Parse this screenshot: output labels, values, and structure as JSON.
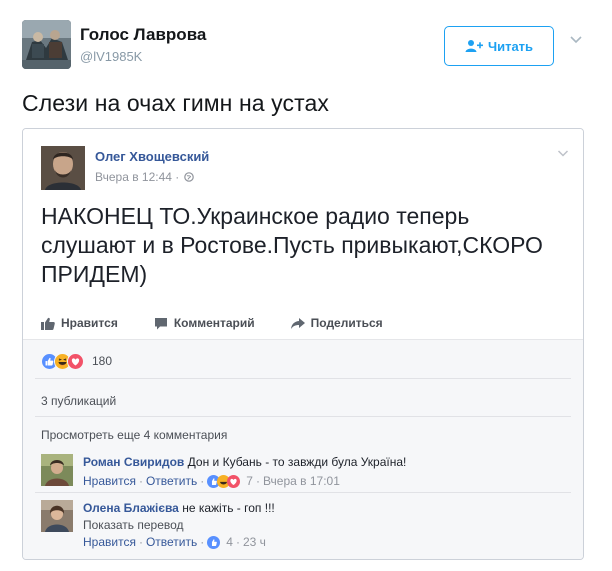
{
  "tweet": {
    "author_name": "Голос Лаврова",
    "author_handle": "@lV1985K",
    "follow_label": "Читать",
    "text": "Слези на очах гимн на устах"
  },
  "fb_post": {
    "author": "Олег Хвощевский",
    "time": "Вчера в 12:44 ·",
    "text": "НАКОНЕЦ ТО.Украинское радио теперь слушают и в Ростове.Пусть привыкают,СКОРО ПРИДЕМ)",
    "actions": {
      "like": "Нравится",
      "comment": "Комментарий",
      "share": "Поделиться"
    },
    "reactions_count": "180",
    "shares_text": "3 публикаций",
    "more_comments": "Просмотреть еще 4 комментария",
    "comments": [
      {
        "author": "Роман Свиридов",
        "text": " Дон и Кубань - то завжди була Україна!",
        "like_label": "Нравится",
        "reply_label": "Ответить",
        "reactions_count": "7",
        "time": "Вчера в 17:01"
      },
      {
        "author": "Олена Блажієва",
        "text": " не кажіть - гоп !!!",
        "translate_label": "Показать перевод",
        "like_label": "Нравится",
        "reply_label": "Ответить",
        "reactions_count": "4",
        "time": "23 ч"
      }
    ]
  },
  "colors": {
    "twitter_blue": "#1da1f2",
    "fb_link_blue": "#365899",
    "fb_like_blue": "#5890ff",
    "fb_love_red": "#f25268",
    "fb_haha_yellow": "#f7b125",
    "muted_gray": "#90949c"
  },
  "icons": {
    "follow": "add-user-icon",
    "tweet_menu": "chevron-down-icon",
    "privacy": "globe-icon",
    "like_action": "thumbs-up-icon",
    "comment_action": "speech-bubble-icon",
    "share_action": "share-arrow-icon",
    "reactions": [
      "like-reaction-icon",
      "haha-reaction-icon",
      "love-reaction-icon"
    ]
  }
}
